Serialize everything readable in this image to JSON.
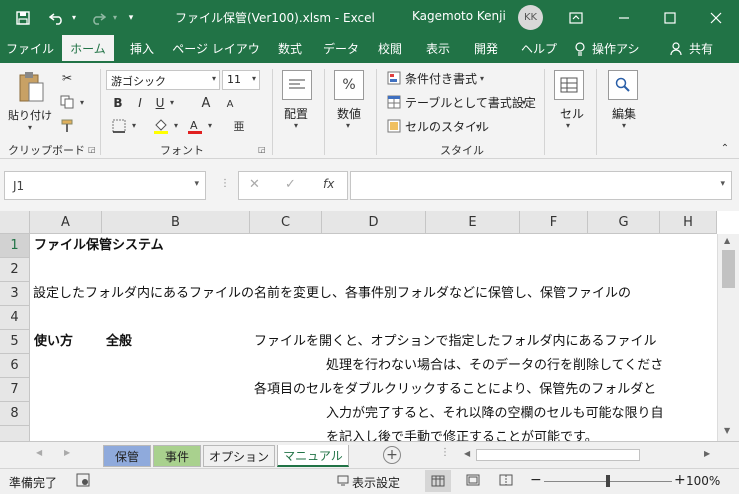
{
  "titlebar": {
    "save_icon": "save-icon",
    "undo_icon": "undo-icon",
    "redo_icon": "redo-icon",
    "customize_icon": "customize-quick-access-icon",
    "title": "ファイル保管(Ver100).xlsm  -  Excel",
    "user": "Kagemoto Kenji",
    "avatar": "KK",
    "ribbon_display_icon": "ribbon-display-options-icon",
    "minimize_icon": "minimize-icon",
    "maximize_icon": "maximize-icon",
    "close_icon": "close-icon"
  },
  "tabs": [
    "ファイル",
    "ホーム",
    "挿入",
    "ページ レイアウト",
    "数式",
    "データ",
    "校閲",
    "表示",
    "開発",
    "ヘルプ"
  ],
  "tell_me": "操作アシ",
  "share": "共有",
  "ribbon": {
    "clipboard": {
      "paste": "貼り付け",
      "label": "クリップボード"
    },
    "font": {
      "name": "游ゴシック",
      "size": "11",
      "bold": "B",
      "italic": "I",
      "underline": "U",
      "grow": "A",
      "shrink": "A",
      "label": "フォント"
    },
    "alignment": {
      "label": "配置"
    },
    "number": {
      "label": "数値",
      "symbol": "%"
    },
    "styles": {
      "conditional": "条件付き書式",
      "table": "テーブルとして書式設定",
      "cell_styles": "セルのスタイル",
      "label": "スタイル"
    },
    "cells": {
      "label": "セル"
    },
    "editing": {
      "label": "編集"
    }
  },
  "formula_bar": {
    "name_box": "J1",
    "cancel": "✕",
    "enter": "✓",
    "fx": "fx",
    "value": ""
  },
  "columns": [
    "A",
    "B",
    "C",
    "D",
    "E",
    "F",
    "G",
    "H"
  ],
  "rows": [
    "1",
    "2",
    "3",
    "4",
    "5",
    "6",
    "7",
    "8"
  ],
  "cells": {
    "r1_a": "ファイル保管システム",
    "r3_a": "設定したフォルダ内にあるファイルの名前を変更し、各事件別フォルダなどに保管し、保管ファイルの",
    "r5_a": "使い方",
    "r5_b": "全般",
    "r5_c": "ファイルを開くと、オプションで指定したフォルダ内にあるファイル",
    "r6_d": "処理を行わない場合は、そのデータの行を削除してくださ",
    "r7_c": "各項目のセルをダブルクリックすることにより、保管先のフォルダと",
    "r8_d": "入力が完了すると、それ以降の空欄のセルも可能な限り自",
    "r9_d": "を記入し後で手動で修正することが可能です。"
  },
  "sheet_tabs": [
    {
      "label": "保管",
      "color": "#8faadc"
    },
    {
      "label": "事件",
      "color": "#a9d18e"
    },
    {
      "label": "オプション",
      "color": ""
    },
    {
      "label": "マニュアル",
      "color": ""
    }
  ],
  "status": {
    "ready": "準備完了",
    "display_settings": "表示設定",
    "zoom": "100%",
    "zoom_out": "−",
    "zoom_in": "+"
  },
  "colors": {
    "excel_green": "#217346",
    "ribbon_bg": "#f3f3f3",
    "header_bg": "#e6e6e6"
  }
}
